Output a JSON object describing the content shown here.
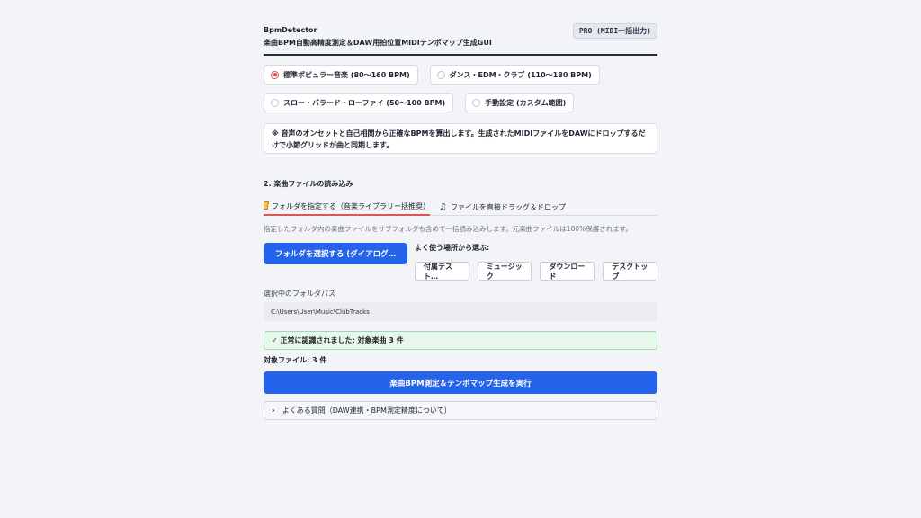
{
  "header": {
    "app_name": "BpmDetector",
    "subtitle": "楽曲BPM自動高精度測定＆DAW用拍位置MIDIテンポマップ生成GUI",
    "badge": "PRO (MIDI一括出力)"
  },
  "modes": [
    {
      "label": "標準ポピュラー音楽 (80〜160 BPM)",
      "selected": true
    },
    {
      "label": "ダンス・EDM・クラブ (110〜180 BPM)",
      "selected": false
    },
    {
      "label": "スロー・バラード・ローファイ (50〜100 BPM)",
      "selected": false
    },
    {
      "label": "手動設定 (カスタム範囲)",
      "selected": false
    }
  ],
  "note": "※ 音声のオンセットと自己相関から正確なBPMを算出します。生成されたMIDIファイルをDAWにドロップするだけで小節グリッドが曲と同期します。",
  "section_title": "2. 楽曲ファイルの読み込み",
  "tabs": [
    {
      "label": "フォルダを指定する（音楽ライブラリー括推奨）",
      "icon": "folder-icon",
      "active": true
    },
    {
      "label": "ファイルを直接ドラッグ＆ドロップ",
      "icon": "music-note-icon",
      "active": false
    }
  ],
  "description": "指定したフォルダ内の楽曲ファイルをサブフォルダも含めて一括読み込みします。元楽曲ファイルは100%保護されます。",
  "select_button": "フォルダを選択する (ダイアログ…",
  "quick_label": "よく使う場所から選ぶ:",
  "quick_buttons": [
    "付属テスト…",
    "ミュージック",
    "ダウンロード",
    "デスクトップ"
  ],
  "path_label": "選択中のフォルダパス",
  "path_value": "C:\\Users\\User\\Music\\ClubTracks",
  "success_message": "✓ 正常に認識されました: 対象楽曲 3 件",
  "file_count": "対象ファイル: 3 件",
  "run_button": "楽曲BPM測定＆テンポマップ生成を実行",
  "faq": {
    "chevron": "›",
    "label": "よくある質問（DAW連携・BPM測定精度について）"
  },
  "colors": {
    "accent": "#2563eb",
    "radio_selected": "#e05552",
    "success_bg": "#e8f7ec"
  }
}
